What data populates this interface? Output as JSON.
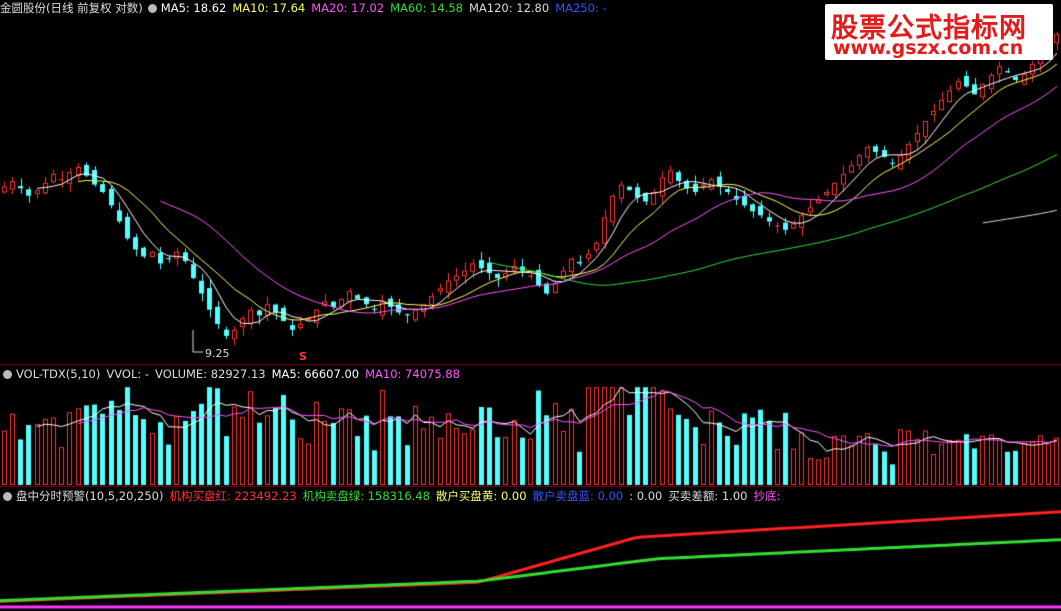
{
  "panel1": {
    "stock": "金圆股份(日线 前复权 对数)",
    "ma": [
      {
        "label": "MA5: 18.62",
        "color": "#ffffff"
      },
      {
        "label": "MA10: 17.64",
        "color": "#ffff66"
      },
      {
        "label": "MA20: 17.02",
        "color": "#ff55ff"
      },
      {
        "label": "MA60: 14.58",
        "color": "#33dd33"
      },
      {
        "label": "MA120: 12.80",
        "color": "#dddddd"
      },
      {
        "label": "MA250: -",
        "color": "#3355ff"
      }
    ],
    "low_label": "9.25",
    "signal_mark": "S"
  },
  "panel2": {
    "title": "VOL-TDX(5,10)",
    "vvol": "VVOL: -",
    "volume": "VOLUME: 82927.13",
    "ma5": "MA5: 66607.00",
    "ma10": "MA10: 74075.88"
  },
  "panel3": {
    "title": "盘中分时预警(10,5,20,250)",
    "items": [
      {
        "label": "机构买盘红: 223492.23",
        "color": "#ff3333"
      },
      {
        "label": "机构卖盘绿: 158316.48",
        "color": "#33dd33"
      },
      {
        "label": "散户买盘黄: 0.00",
        "color": "#ffff66"
      },
      {
        "label": "散户卖盘蓝: 0.00",
        "color": "#3355ff"
      },
      {
        "label": ": 0.00",
        "color": "#dddddd"
      },
      {
        "label": "买卖差额: 1.00",
        "color": "#dddddd"
      },
      {
        "label": "抄底:",
        "color": "#ff55ff"
      }
    ]
  },
  "watermark": {
    "line1": "股票公式指标网",
    "line2": "www.gszx.com.cn"
  },
  "colors": {
    "up": "#ff3333",
    "down": "#54ffff",
    "ma5": "#ffffff",
    "ma10": "#ffff66",
    "ma20": "#ff55ff",
    "ma60": "#33dd33",
    "ma120": "#dddddd"
  },
  "chart_data": {
    "type": "candlestick",
    "price_low": 9.25,
    "price_axis": "log",
    "candles_count": 150,
    "ohlc_close_path": [
      16.1,
      16.4,
      16.0,
      15.6,
      15.9,
      16.3,
      16.8,
      16.5,
      16.9,
      17.2,
      16.7,
      16.2,
      15.8,
      15.1,
      14.3,
      13.5,
      13.0,
      12.7,
      12.9,
      12.4,
      12.6,
      12.9,
      12.5,
      11.8,
      11.2,
      10.6,
      10.1,
      9.7,
      9.9,
      10.3,
      10.6,
      10.4,
      10.8,
      10.5,
      10.2,
      9.9,
      10.1,
      10.3,
      10.6,
      10.9,
      10.7,
      11.0,
      11.3,
      11.0,
      10.8,
      10.6,
      10.9,
      10.7,
      10.5,
      10.4,
      10.6,
      10.8,
      11.1,
      11.4,
      11.7,
      11.9,
      12.1,
      12.4,
      12.2,
      12.0,
      11.8,
      12.0,
      12.3,
      12.1,
      11.9,
      11.5,
      11.2,
      11.6,
      12.1,
      12.6,
      12.4,
      12.8,
      13.3,
      14.5,
      15.6,
      16.2,
      15.9,
      15.5,
      15.3,
      15.8,
      16.6,
      17.0,
      16.4,
      16.0,
      15.8,
      16.2,
      16.5,
      16.1,
      15.8,
      15.4,
      15.1,
      14.8,
      14.6,
      14.3,
      14.1,
      13.9,
      14.2,
      14.6,
      15.0,
      15.4,
      15.8,
      16.3,
      16.8,
      17.3,
      17.9,
      18.4,
      18.1,
      17.8,
      17.4,
      17.9,
      18.6,
      19.3,
      20.1,
      20.8,
      21.6,
      22.3,
      23.0,
      22.6,
      22.0,
      22.8,
      23.5,
      24.2,
      23.7,
      23.1,
      23.6,
      24.4,
      25.3,
      26.2,
      27.0
    ],
    "volume_range": [
      0,
      260000
    ],
    "last_volume": 82927.13,
    "vol_ma5": 66607.0,
    "vol_ma10": 74075.88,
    "series": [
      {
        "name": "机构买盘红",
        "last": 223492.23
      },
      {
        "name": "机构卖盘绿",
        "last": 158316.48
      }
    ]
  }
}
